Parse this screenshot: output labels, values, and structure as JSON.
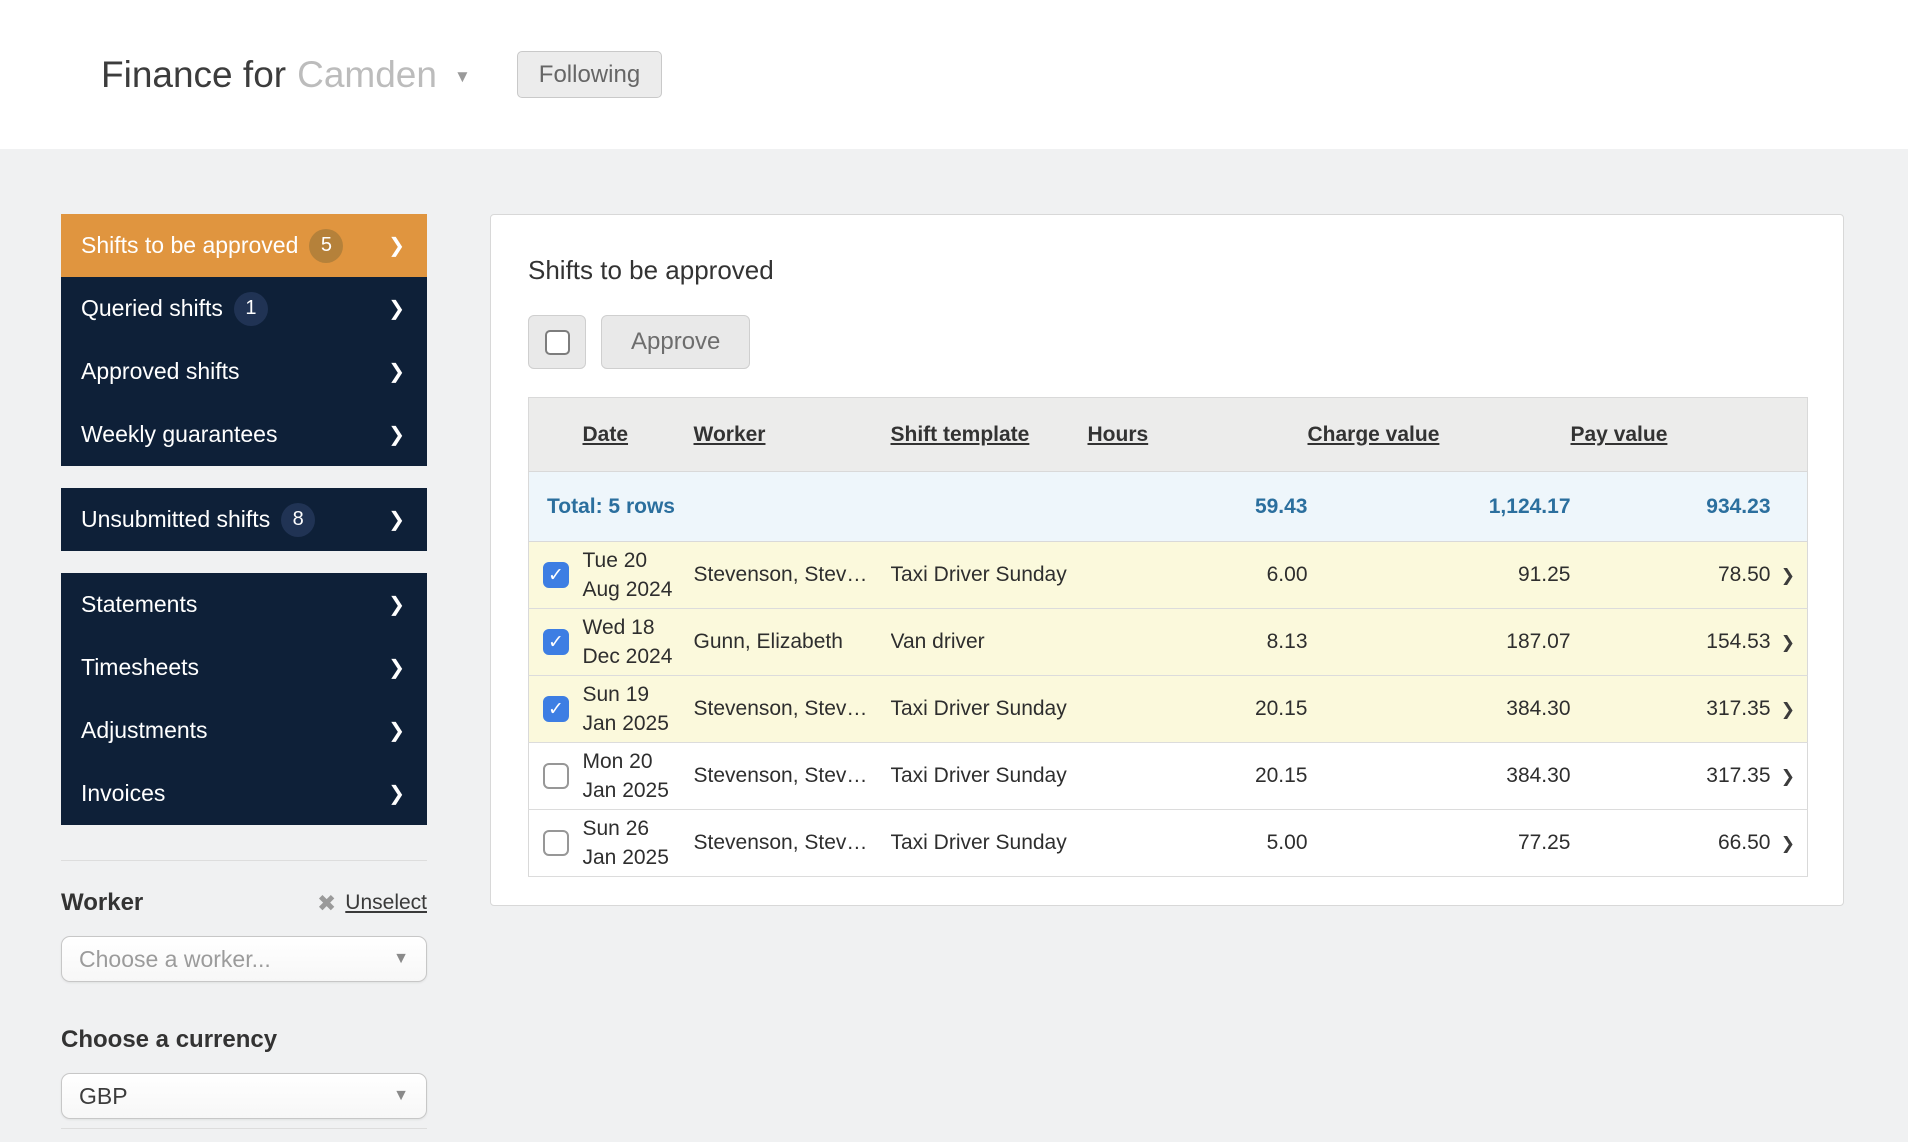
{
  "icons": {
    "caret_down": "▼",
    "chevron_right": "❯",
    "close": "✖",
    "checkmark": "✓"
  },
  "colors": {
    "sidebar_navy": "#0e2038",
    "active_orange": "#e0953f",
    "badge_orange": "#b5813a",
    "badge_navy": "#203354",
    "selected_row_yellow": "#fbf9dc",
    "total_row_blue_bg": "#eef6fb",
    "total_text_blue": "#2b6f9e",
    "checkbox_blue": "#3d7ee3",
    "page_background": "#f0f1f2"
  },
  "header": {
    "title_primary": "Finance for",
    "title_secondary": "Camden",
    "following_button": "Following"
  },
  "sidebar": {
    "groups": [
      {
        "items": [
          {
            "label": "Shifts to be approved",
            "badge": "5",
            "active": true
          },
          {
            "label": "Queried shifts",
            "badge": "1",
            "active": false
          },
          {
            "label": "Approved shifts",
            "active": false
          },
          {
            "label": "Weekly guarantees",
            "active": false
          }
        ]
      },
      {
        "items": [
          {
            "label": "Unsubmitted shifts",
            "badge": "8",
            "active": false
          }
        ]
      },
      {
        "items": [
          {
            "label": "Statements",
            "active": false
          },
          {
            "label": "Timesheets",
            "active": false
          },
          {
            "label": "Adjustments",
            "active": false
          },
          {
            "label": "Invoices",
            "active": false
          }
        ]
      }
    ],
    "worker_label": "Worker",
    "unselect_label": "Unselect",
    "worker_placeholder": "Choose a worker...",
    "currency_label": "Choose a currency",
    "currency_value": "GBP"
  },
  "main": {
    "heading": "Shifts to be approved",
    "approve_button": "Approve",
    "table": {
      "columns": {
        "date": "Date",
        "worker": "Worker",
        "template": "Shift template",
        "hours": "Hours",
        "charge": "Charge value",
        "pay": "Pay value"
      },
      "total_label": "Total: 5 rows",
      "totals": {
        "hours": "59.43",
        "charge": "1,124.17",
        "pay": "934.23"
      },
      "rows": [
        {
          "checked": true,
          "date_line1": "Tue 20",
          "date_line2": "Aug 2024",
          "worker": "Stevenson, Stev…",
          "template": "Taxi Driver Sunday",
          "hours": "6.00",
          "charge": "91.25",
          "pay": "78.50"
        },
        {
          "checked": true,
          "date_line1": "Wed 18",
          "date_line2": "Dec 2024",
          "worker": "Gunn, Elizabeth",
          "template": "Van driver",
          "hours": "8.13",
          "charge": "187.07",
          "pay": "154.53"
        },
        {
          "checked": true,
          "date_line1": "Sun 19",
          "date_line2": "Jan 2025",
          "worker": "Stevenson, Stev…",
          "template": "Taxi Driver Sunday",
          "hours": "20.15",
          "charge": "384.30",
          "pay": "317.35"
        },
        {
          "checked": false,
          "date_line1": "Mon 20",
          "date_line2": "Jan 2025",
          "worker": "Stevenson, Stev…",
          "template": "Taxi Driver Sunday",
          "hours": "20.15",
          "charge": "384.30",
          "pay": "317.35"
        },
        {
          "checked": false,
          "date_line1": "Sun 26",
          "date_line2": "Jan 2025",
          "worker": "Stevenson, Stev…",
          "template": "Taxi Driver Sunday",
          "hours": "5.00",
          "charge": "77.25",
          "pay": "66.50"
        }
      ]
    }
  }
}
